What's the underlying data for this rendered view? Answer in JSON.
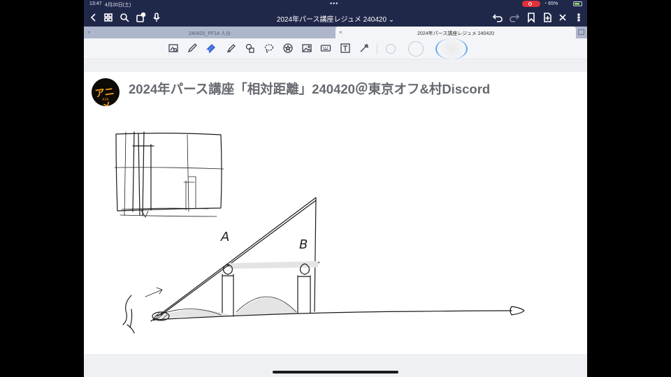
{
  "status_bar": {
    "time": "13:47",
    "date": "4月20日(土)",
    "battery": "65%",
    "colors": {
      "recording": "#e0313a",
      "battery_fill": "#7ed957"
    }
  },
  "app_bar": {
    "title": "2024年パース講座レジュメ 240420",
    "title_chevron": "⌄",
    "left_icons": [
      "back-icon",
      "grid-icon",
      "search-icon",
      "share-icon",
      "mic-icon"
    ],
    "right_icons": [
      "undo-icon",
      "redo-icon",
      "bookmark-icon",
      "add-page-icon",
      "close-icon",
      "more-icon"
    ],
    "background": "#20284a"
  },
  "tabs": [
    {
      "label": "240420_PF14 人分",
      "active": false,
      "close": "×"
    },
    {
      "label": "2024年パース講座レジュメ 240420",
      "active": true,
      "close": "×"
    }
  ],
  "tools": [
    "lasso-image-icon",
    "pen-icon",
    "eraser-icon",
    "highlighter-icon",
    "shapes-icon",
    "lasso-icon",
    "sticker-icon",
    "image-icon",
    "keyboard-icon",
    "textbox-icon",
    "laser-pointer-icon"
  ],
  "pen_sizes": [
    "small",
    "medium",
    "large-selected"
  ],
  "page": {
    "logo_text": "アニメ",
    "logo_subtext": "ASK",
    "heading": "2024年パース講座「相対距離」240420＠東京オフ&村Discord",
    "sketch_labels": {
      "a": "A",
      "b": "B"
    }
  }
}
